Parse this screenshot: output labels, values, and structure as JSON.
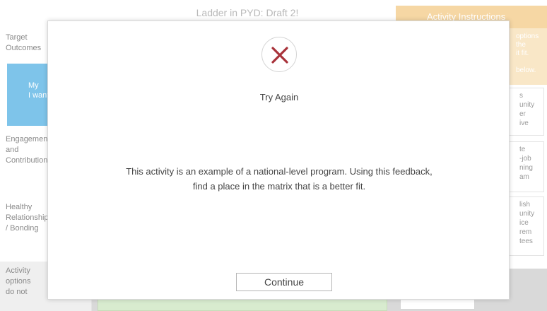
{
  "background": {
    "matrix_title": "Ladder in PYD: Draft 2!",
    "row_labels": [
      {
        "text": "Target\nOutcomes"
      },
      {
        "text": "Engagement\nand\nContribution"
      },
      {
        "text": "Healthy\nRelationships\n/ Bonding"
      },
      {
        "text": "Activity\noptions\ndo not"
      }
    ],
    "active_row": {
      "text": "My\nI want"
    },
    "instructions": {
      "title": "Activity Instructions",
      "body": "options\nthe\nit fit.\n\nbelow."
    },
    "right_cards": [
      {
        "text": "s\nunity\ner\nive"
      },
      {
        "text": "te\n-job\nning\nam"
      },
      {
        "text": "lish\nunity\nice\nrem\ntees"
      }
    ]
  },
  "modal": {
    "icon": "close-x-icon",
    "icon_color": "#a8323a",
    "title": "Try Again",
    "feedback": "This activity is an example of a national-level program. Using this feedback, find a place in the matrix that is a better fit.",
    "continue_label": "Continue"
  }
}
